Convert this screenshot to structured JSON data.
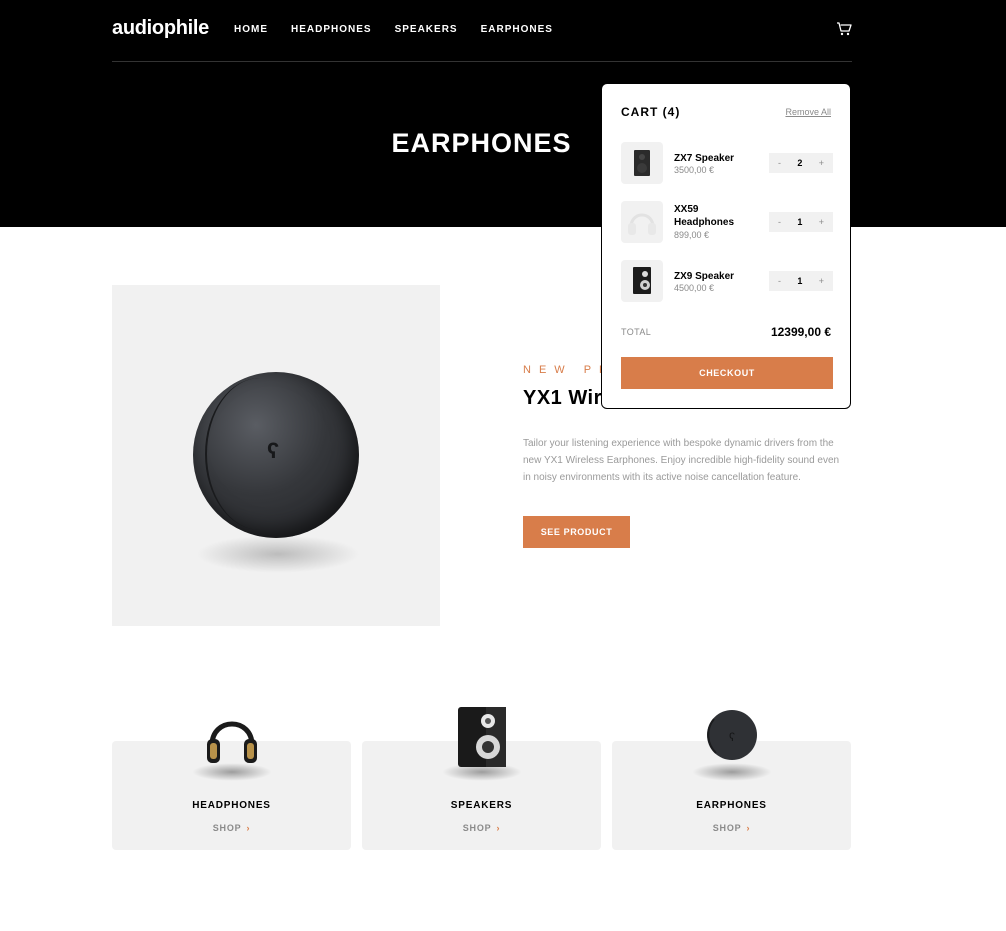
{
  "header": {
    "logo": "audiophile",
    "nav": [
      "HOME",
      "HEADPHONES",
      "SPEAKERS",
      "EARPHONES"
    ],
    "cart_icon": "cart-icon"
  },
  "hero": {
    "title": "EARPHONES"
  },
  "product": {
    "overline": "NEW PRODUCT",
    "title": "YX1 Wireless Earphones",
    "description": "Tailor your listening experience with bespoke dynamic drivers from the new YX1 Wireless Earphones. Enjoy incredible high-fidelity sound even in noisy environments with its active noise cancellation feature.",
    "button_label": "SEE PRODUCT"
  },
  "categories": [
    {
      "name": "HEADPHONES",
      "shop": "SHOP",
      "chevron": "›"
    },
    {
      "name": "SPEAKERS",
      "shop": "SHOP",
      "chevron": "›"
    },
    {
      "name": "EARPHONES",
      "shop": "SHOP",
      "chevron": "›"
    }
  ],
  "cart": {
    "title": "CART (4)",
    "remove_all": "Remove All",
    "items": [
      {
        "name": "ZX7 Speaker",
        "price": "3500,00 €",
        "qty": "2",
        "minus": "-",
        "plus": "+"
      },
      {
        "name": "XX59 Headphones",
        "price": "899,00 €",
        "qty": "1",
        "minus": "-",
        "plus": "+"
      },
      {
        "name": "ZX9 Speaker",
        "price": "4500,00 €",
        "qty": "1",
        "minus": "-",
        "plus": "+"
      }
    ],
    "total_label": "TOTAL",
    "total_value": "12399,00 €",
    "checkout_label": "CHECKOUT"
  },
  "colors": {
    "accent": "#d87d4a",
    "dark": "#000000",
    "light_gray": "#f1f1f1"
  }
}
